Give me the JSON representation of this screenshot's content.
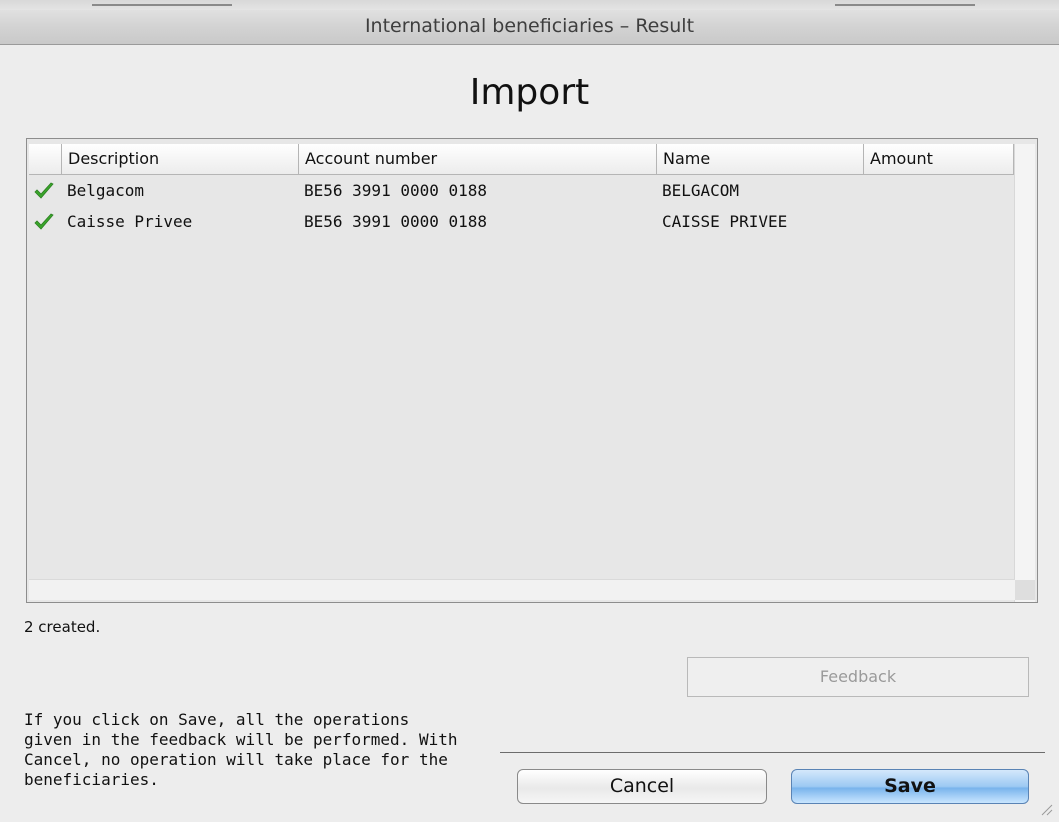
{
  "window": {
    "title": "International beneficiaries – Result"
  },
  "heading": "Import",
  "table": {
    "columns": [
      "",
      "Description",
      "Account number",
      "Name",
      "Amount"
    ],
    "rows": [
      {
        "status_icon": "checkmark-icon",
        "description": "Belgacom",
        "account": "BE56 3991 0000 0188",
        "name": "BELGACOM",
        "amount": ""
      },
      {
        "status_icon": "checkmark-icon",
        "description": "Caisse Privee",
        "account": "BE56 3991 0000 0188",
        "name": "CAISSE PRIVEE",
        "amount": ""
      }
    ]
  },
  "status": "2 created.",
  "feedback_button": "Feedback",
  "info_text": "If you click on Save, all the operations\ngiven in the feedback will be performed. With\nCancel, no operation will take place for the\nbeneficiaries.",
  "buttons": {
    "cancel": "Cancel",
    "save": "Save"
  },
  "colors": {
    "success_check": "#3aa62b",
    "save_button": "#8cc2f1",
    "feedback_disabled_text": "#9a9a9a"
  }
}
